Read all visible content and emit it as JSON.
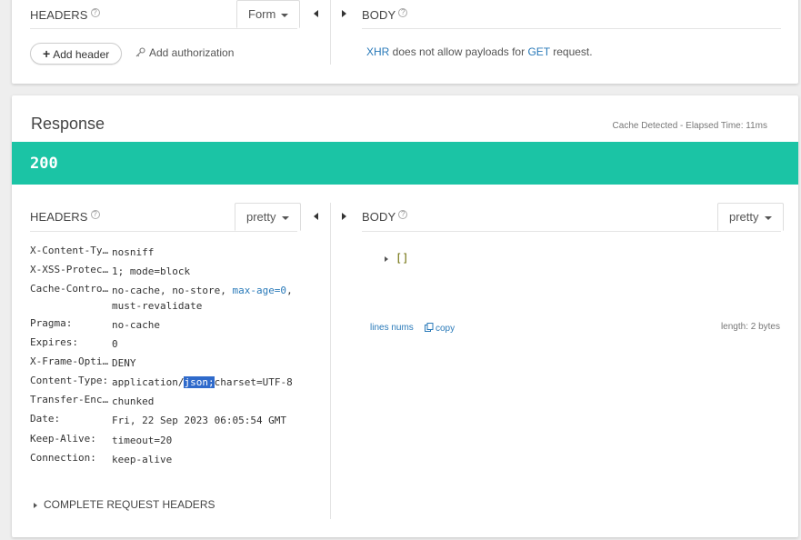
{
  "request": {
    "headers_title": "HEADERS",
    "help_icon": "?",
    "headers_mode": "Form",
    "body_title": "BODY",
    "add_header_label": "Add header",
    "add_auth_label": "Add authorization",
    "xhr_msg": {
      "xhr": "XHR",
      "middle": " does not allow payloads for ",
      "method": "GET",
      "end": " request."
    }
  },
  "response": {
    "title": "Response",
    "meta": "Cache Detected - Elapsed Time: 11ms",
    "status_code": "200",
    "status_color": "#1bc4a5",
    "headers_title": "HEADERS",
    "headers_mode": "pretty",
    "body_title": "BODY",
    "body_mode": "pretty",
    "headers": [
      {
        "key": "X-Content-Ty…",
        "value": "nosniff"
      },
      {
        "key": "X-XSS-Protec…",
        "value": "1; mode=block"
      },
      {
        "key": "Cache-Contro…",
        "value_parts": [
          "no-cache, no-store, ",
          "max-age=0",
          ","
        ],
        "value_line2": "must-revalidate"
      },
      {
        "key": "Pragma:",
        "value": "no-cache"
      },
      {
        "key": "Expires:",
        "value": "0"
      },
      {
        "key": "X-Frame-Opti…",
        "value": "DENY"
      },
      {
        "key": "Content-Type:",
        "value_parts": [
          "application/",
          "json;",
          "charset=UTF-8"
        ]
      },
      {
        "key": "Transfer-Enc…",
        "value": "chunked"
      },
      {
        "key": "Date:",
        "value": "Fri, 22 Sep 2023 06:05:54 GMT"
      },
      {
        "key": "Keep-Alive:",
        "value": "timeout=20"
      },
      {
        "key": "Connection:",
        "value": "keep-alive"
      }
    ],
    "complete_headers_label": "COMPLETE REQUEST HEADERS",
    "body_json": "[]",
    "lines_nums_label": "lines nums",
    "copy_label": "copy",
    "length_label": "length: 2 bytes"
  }
}
